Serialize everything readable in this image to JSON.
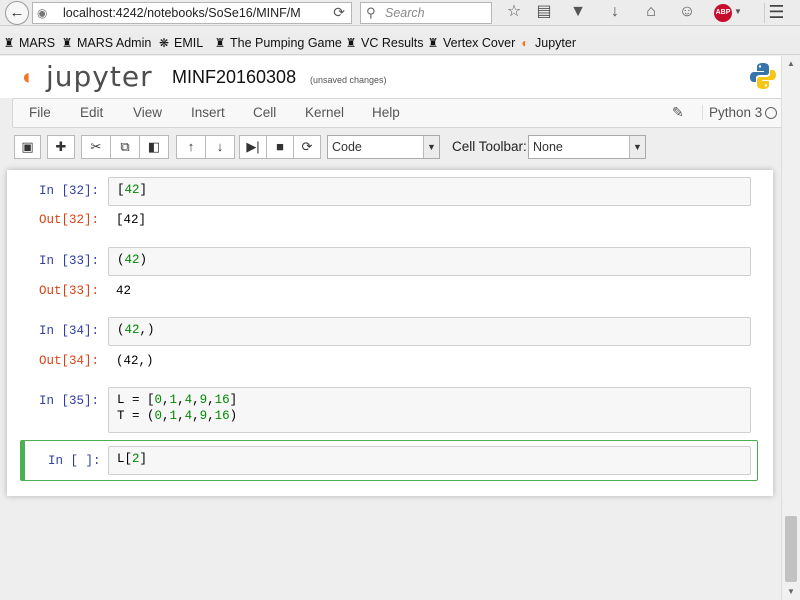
{
  "browser": {
    "url": "localhost:4242/notebooks/SoSe16/MINF/M",
    "search_placeholder": "Search",
    "abp_label": "ABP"
  },
  "bookmarks": [
    {
      "label": "MARS",
      "icon": "mask-icon"
    },
    {
      "label": "MARS Admin",
      "icon": "mask-icon"
    },
    {
      "label": "EMIL",
      "icon": "emil-icon"
    },
    {
      "label": "The Pumping Game",
      "icon": "mask-icon"
    },
    {
      "label": "VC Results",
      "icon": "mask-icon"
    },
    {
      "label": "Vertex Cover",
      "icon": "mask-icon"
    },
    {
      "label": "Jupyter",
      "icon": "jupyter-icon"
    }
  ],
  "header": {
    "logo_text": "jupyter",
    "notebook_name": "MINF20160308",
    "save_status": "(unsaved changes)"
  },
  "menu": {
    "items": [
      "File",
      "Edit",
      "View",
      "Insert",
      "Cell",
      "Kernel",
      "Help"
    ],
    "kernel_name": "Python 3"
  },
  "toolbar": {
    "cell_type": "Code",
    "cell_toolbar_label": "Cell Toolbar:",
    "cell_toolbar_value": "None"
  },
  "cells": {
    "c1": {
      "in_prompt": "In [32]:",
      "input": "[42]",
      "out_prompt": "Out[32]:",
      "output": "[42]"
    },
    "c2": {
      "in_prompt": "In [33]:",
      "input": "(42)",
      "out_prompt": "Out[33]:",
      "output": "42"
    },
    "c3": {
      "in_prompt": "In [34]:",
      "input": "(42,)",
      "out_prompt": "Out[34]:",
      "output": "(42,)"
    },
    "c4": {
      "in_prompt": "In [35]:",
      "input_line1": "L = [0,1,4,9,16]",
      "input_line2": "T = (0,1,4,9,16)"
    },
    "c5": {
      "in_prompt": "In [ ]:",
      "input": "L[2]"
    }
  },
  "colors": {
    "accent": "#f37626",
    "selected_cell": "#4caf50",
    "in_prompt": "#303f9f",
    "out_prompt": "#d84315"
  }
}
